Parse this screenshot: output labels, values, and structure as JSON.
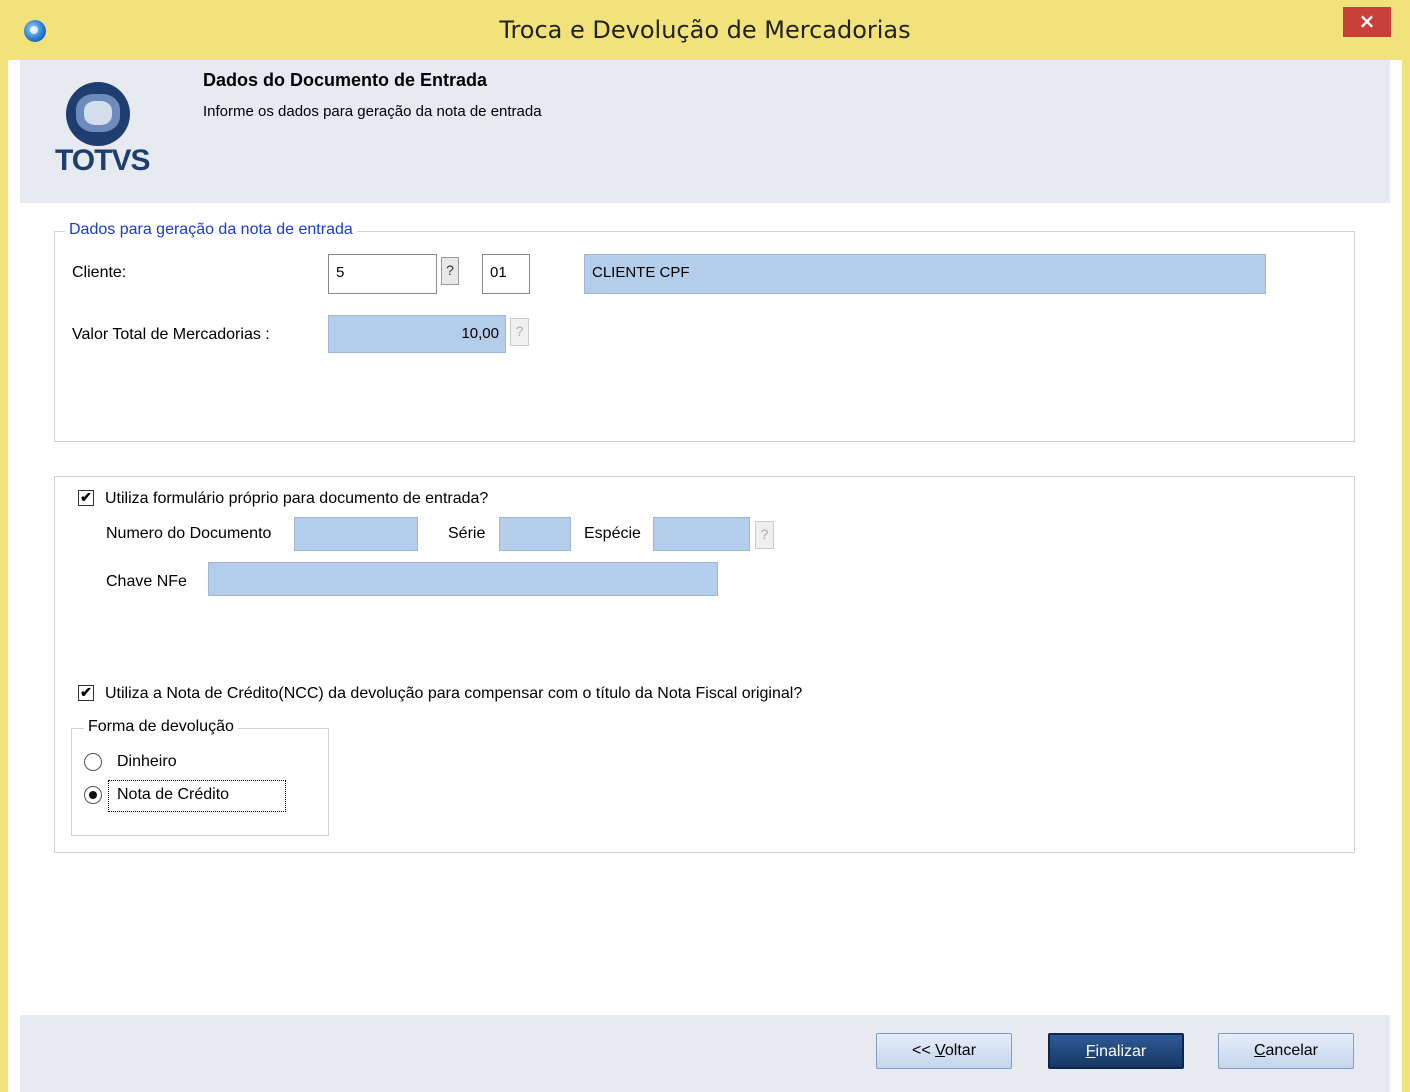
{
  "window": {
    "title": "Troca e Devolução de Mercadorias",
    "close_label": "×"
  },
  "header": {
    "logo_text": "TOTVS",
    "title": "Dados do Documento de Entrada",
    "subtitle": "Informe os dados para geração da nota de entrada"
  },
  "group1": {
    "legend": "Dados para geração da nota de entrada",
    "cliente_label": "Cliente:",
    "cliente_code": "5",
    "cliente_loja": "01",
    "cliente_name": "CLIENTE CPF",
    "lookup_label": "?",
    "valor_label": "Valor Total de Mercadorias :",
    "valor_value": "10,00"
  },
  "group2": {
    "formulario_checked": true,
    "formulario_label": "Utiliza formulário próprio para documento de entrada?",
    "numero_label": "Numero do Documento",
    "serie_label": "Série",
    "especie_label": "Espécie",
    "chave_label": "Chave NFe",
    "ncc_checked": true,
    "ncc_label": "Utiliza a Nota de Crédito(NCC) da devolução para compensar com o título da Nota Fiscal original?",
    "forma_legend": "Forma de devolução",
    "forma_options": [
      "Dinheiro",
      "Nota de Crédito"
    ],
    "forma_selected": "Nota de Crédito"
  },
  "footer": {
    "voltar_prefix": "<< ",
    "voltar_mnemonic": "V",
    "voltar_rest": "oltar",
    "finalizar_mnemonic": "F",
    "finalizar_rest": "inalizar",
    "cancelar_mnemonic": "C",
    "cancelar_rest": "ancelar"
  }
}
